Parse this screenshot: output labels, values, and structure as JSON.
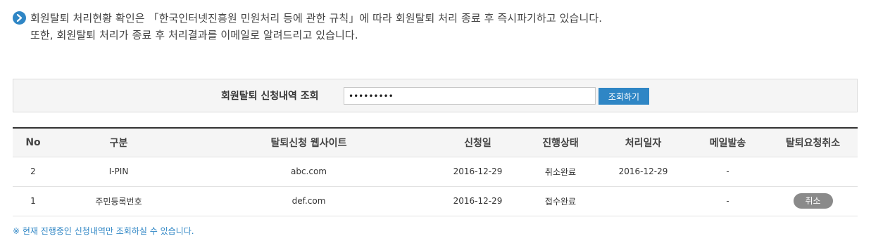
{
  "notice": {
    "icon": "chevron-right-circle-icon",
    "line1": "회원탈퇴 처리현황 확인은 「한국인터넷진흥원 민원처리 등에 관한 규칙」에 따라 회원탈퇴 처리 종료 후 즉시파기하고 있습니다.",
    "line2": "또한, 회원탈퇴 처리가 종료 후 처리결과를 이메일로 알려드리고 있습니다."
  },
  "search": {
    "label": "회원탈퇴 신청내역 조회",
    "value": "•••••••••",
    "button_label": "조회하기"
  },
  "table": {
    "headers": [
      "No",
      "구분",
      "탈퇴신청 웹사이트",
      "신청일",
      "진행상태",
      "처리일자",
      "메일발송",
      "탈퇴요청취소"
    ],
    "rows": [
      {
        "no": "2",
        "type": "I-PIN",
        "website": "abc.com",
        "request_date": "2016-12-29",
        "status": "취소완료",
        "processed_date": "2016-12-29",
        "mail": "-",
        "cancel": ""
      },
      {
        "no": "1",
        "type": "주민등록번호",
        "website": "def.com",
        "request_date": "2016-12-29",
        "status": "접수완료",
        "processed_date": "",
        "mail": "-",
        "cancel": "취소"
      }
    ]
  },
  "footnote": "※ 현재 진행중인 신청내역만 조회하실 수 있습니다.",
  "colors": {
    "accent": "#2f86c5",
    "cancel_button": "#8a8a8a",
    "header_bg": "#f5f5f5"
  }
}
